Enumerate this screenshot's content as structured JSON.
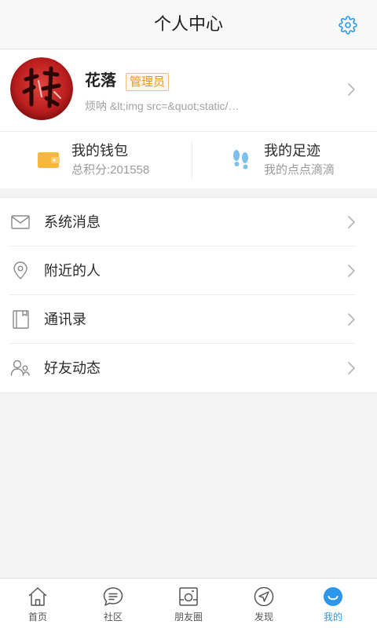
{
  "header": {
    "title": "个人中心",
    "settings_icon": "gear-icon"
  },
  "profile": {
    "avatar": "avatar-image",
    "name": "花落",
    "badge": "管理员",
    "signature": "烦呐 &lt;img src=&quot;static/…",
    "chevron_icon": "chevron-right-icon"
  },
  "quick": [
    {
      "title": "我的钱包",
      "sub": "总积分:201558",
      "icon": "wallet-icon"
    },
    {
      "title": "我的足迹",
      "sub": "我的点点滴滴",
      "icon": "footprints-icon"
    }
  ],
  "menu": [
    {
      "label": "系统消息",
      "icon": "mail-icon"
    },
    {
      "label": "附近的人",
      "icon": "location-pin-icon"
    },
    {
      "label": "通讯录",
      "icon": "contacts-book-icon"
    },
    {
      "label": "好友动态",
      "icon": "friends-icon"
    }
  ],
  "tabs": [
    {
      "label": "首页",
      "icon": "home-icon",
      "active": false
    },
    {
      "label": "社区",
      "icon": "chat-bubble-icon",
      "active": false
    },
    {
      "label": "朋友圈",
      "icon": "photo-frame-icon",
      "active": false
    },
    {
      "label": "发现",
      "icon": "navigation-icon",
      "active": false
    },
    {
      "label": "我的",
      "icon": "smiley-face-icon",
      "active": true
    }
  ],
  "colors": {
    "accent": "#2c97ea",
    "badge": "#f0931e",
    "wallet": "#f6b73c",
    "footprints": "#7cc0ee"
  }
}
